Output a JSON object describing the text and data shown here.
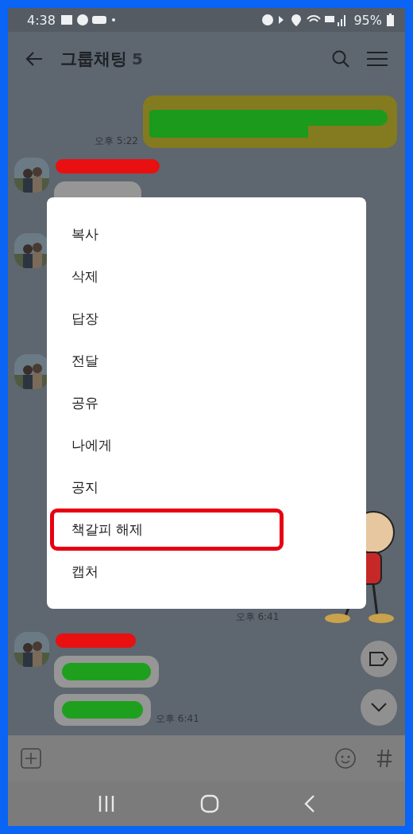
{
  "status_bar": {
    "time": "4:38",
    "battery": "95%"
  },
  "header": {
    "title": "그룹채팅",
    "member_count": "5"
  },
  "messages": [
    {
      "kind": "outgoing",
      "time": "오후 5:22"
    },
    {
      "kind": "incoming"
    },
    {
      "kind": "avatar"
    },
    {
      "kind": "avatar"
    },
    {
      "kind": "sticker",
      "time": "오후 6:41"
    },
    {
      "kind": "incoming_pair",
      "time": "오후 6:41"
    }
  ],
  "context_menu": {
    "items": [
      {
        "label": "복사",
        "highlighted": false
      },
      {
        "label": "삭제",
        "highlighted": false
      },
      {
        "label": "답장",
        "highlighted": false
      },
      {
        "label": "전달",
        "highlighted": false
      },
      {
        "label": "공유",
        "highlighted": false
      },
      {
        "label": "나에게",
        "highlighted": false
      },
      {
        "label": "공지",
        "highlighted": false
      },
      {
        "label": "책갈피 해제",
        "highlighted": true
      },
      {
        "label": "캡처",
        "highlighted": false
      }
    ]
  }
}
